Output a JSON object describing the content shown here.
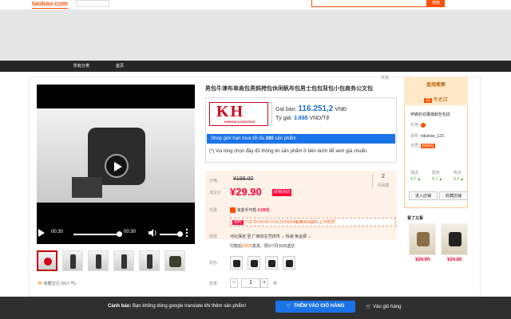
{
  "header": {
    "logo": "taobao.com",
    "search_button": "搜索"
  },
  "nav": {
    "items": [
      "所有分类",
      "首页"
    ]
  },
  "report_label": "举报",
  "product": {
    "title": "男包牛津布单肩包男斜挎包休闲帆布包男士包包背包小包商务公文包",
    "logistics_logo": "KH",
    "logistics_name": "KINHOA LOGISTICS",
    "price_label": "Giá bán:",
    "price_value": "116.251,2",
    "price_currency": "VNĐ",
    "rate_label": "Tỷ giá:",
    "rate_value": "3.888",
    "rate_unit": "VND/Tệ",
    "limit_text_pre": "Shop giới hạn mua tối đa",
    "limit_value": "280",
    "limit_text_post": "sản phẩm",
    "note": "(*) Vui lòng chọn đầy đủ thông tin sản phẩm ở bên dưới để xem giá chuẩn."
  },
  "video": {
    "time_current": "00:30",
    "time_total": "00:30"
  },
  "favorite": {
    "label": "收藏宝贝",
    "count": "(55人气)"
  },
  "pricing": {
    "orig_label": "价格",
    "orig_price": "¥198.00",
    "sale_label": "淘宝价",
    "sale_price": "¥29.90",
    "sale_tag": "促销活动",
    "count": "2",
    "count_label": "月销量",
    "promo_label": "优惠",
    "promo_text": "淘金币可抵",
    "promo_value": "0.59元",
    "promo2_tag": "限时",
    "promo2_text": "7/12 20:00:00-7/15 23:59:59每满300减30,上不封顶",
    "ship_label": "配送",
    "ship_text": "河北保定 至  广西崇左凭祥市 ⌄   快递 免运费 ⌄",
    "ship_text2_pre": "付款后",
    "ship_text2_hl": "3天内",
    "ship_text2_post": "发货，预计7月16日送达"
  },
  "options": {
    "color_label": "颜色",
    "qty_label": "数量",
    "qty_value": "1",
    "qty_minus": "−",
    "qty_plus": "+",
    "qty_unit": "件"
  },
  "shop": {
    "gold_seller": "金冠卖家",
    "years_badge": "10",
    "years_text": "年老店",
    "name": "伊森豹纹董旗舰包包店",
    "level_label": "信誉:",
    "owner_label": "掌柜:",
    "owner_value": "nibuhao_123",
    "qual_label": "资质:",
    "qual_value": "消保保证",
    "scores": [
      {
        "label": "描述",
        "value": "4.7 ▲"
      },
      {
        "label": "服务",
        "value": "4.7 ▲"
      },
      {
        "label": "物流",
        "value": "4.7 ▲"
      }
    ],
    "enter_button": "进入店铺",
    "fav_button": "收藏店铺",
    "seen_title": "看了又看",
    "seen_prices": [
      "¥24.90",
      "¥24.80"
    ]
  },
  "bottom": {
    "warn_label": "Cảnh báo:",
    "warn_text": "Bạn không dùng google translate khi thêm sản phẩm!",
    "add_cart": "THÊM VÀO GIỎ HÀNG",
    "go_cart": "Vào giỏ hàng"
  },
  "colors": {
    "brand": "#ff5000",
    "price_red": "#ff0036",
    "accent_blue": "#1a73e8"
  }
}
